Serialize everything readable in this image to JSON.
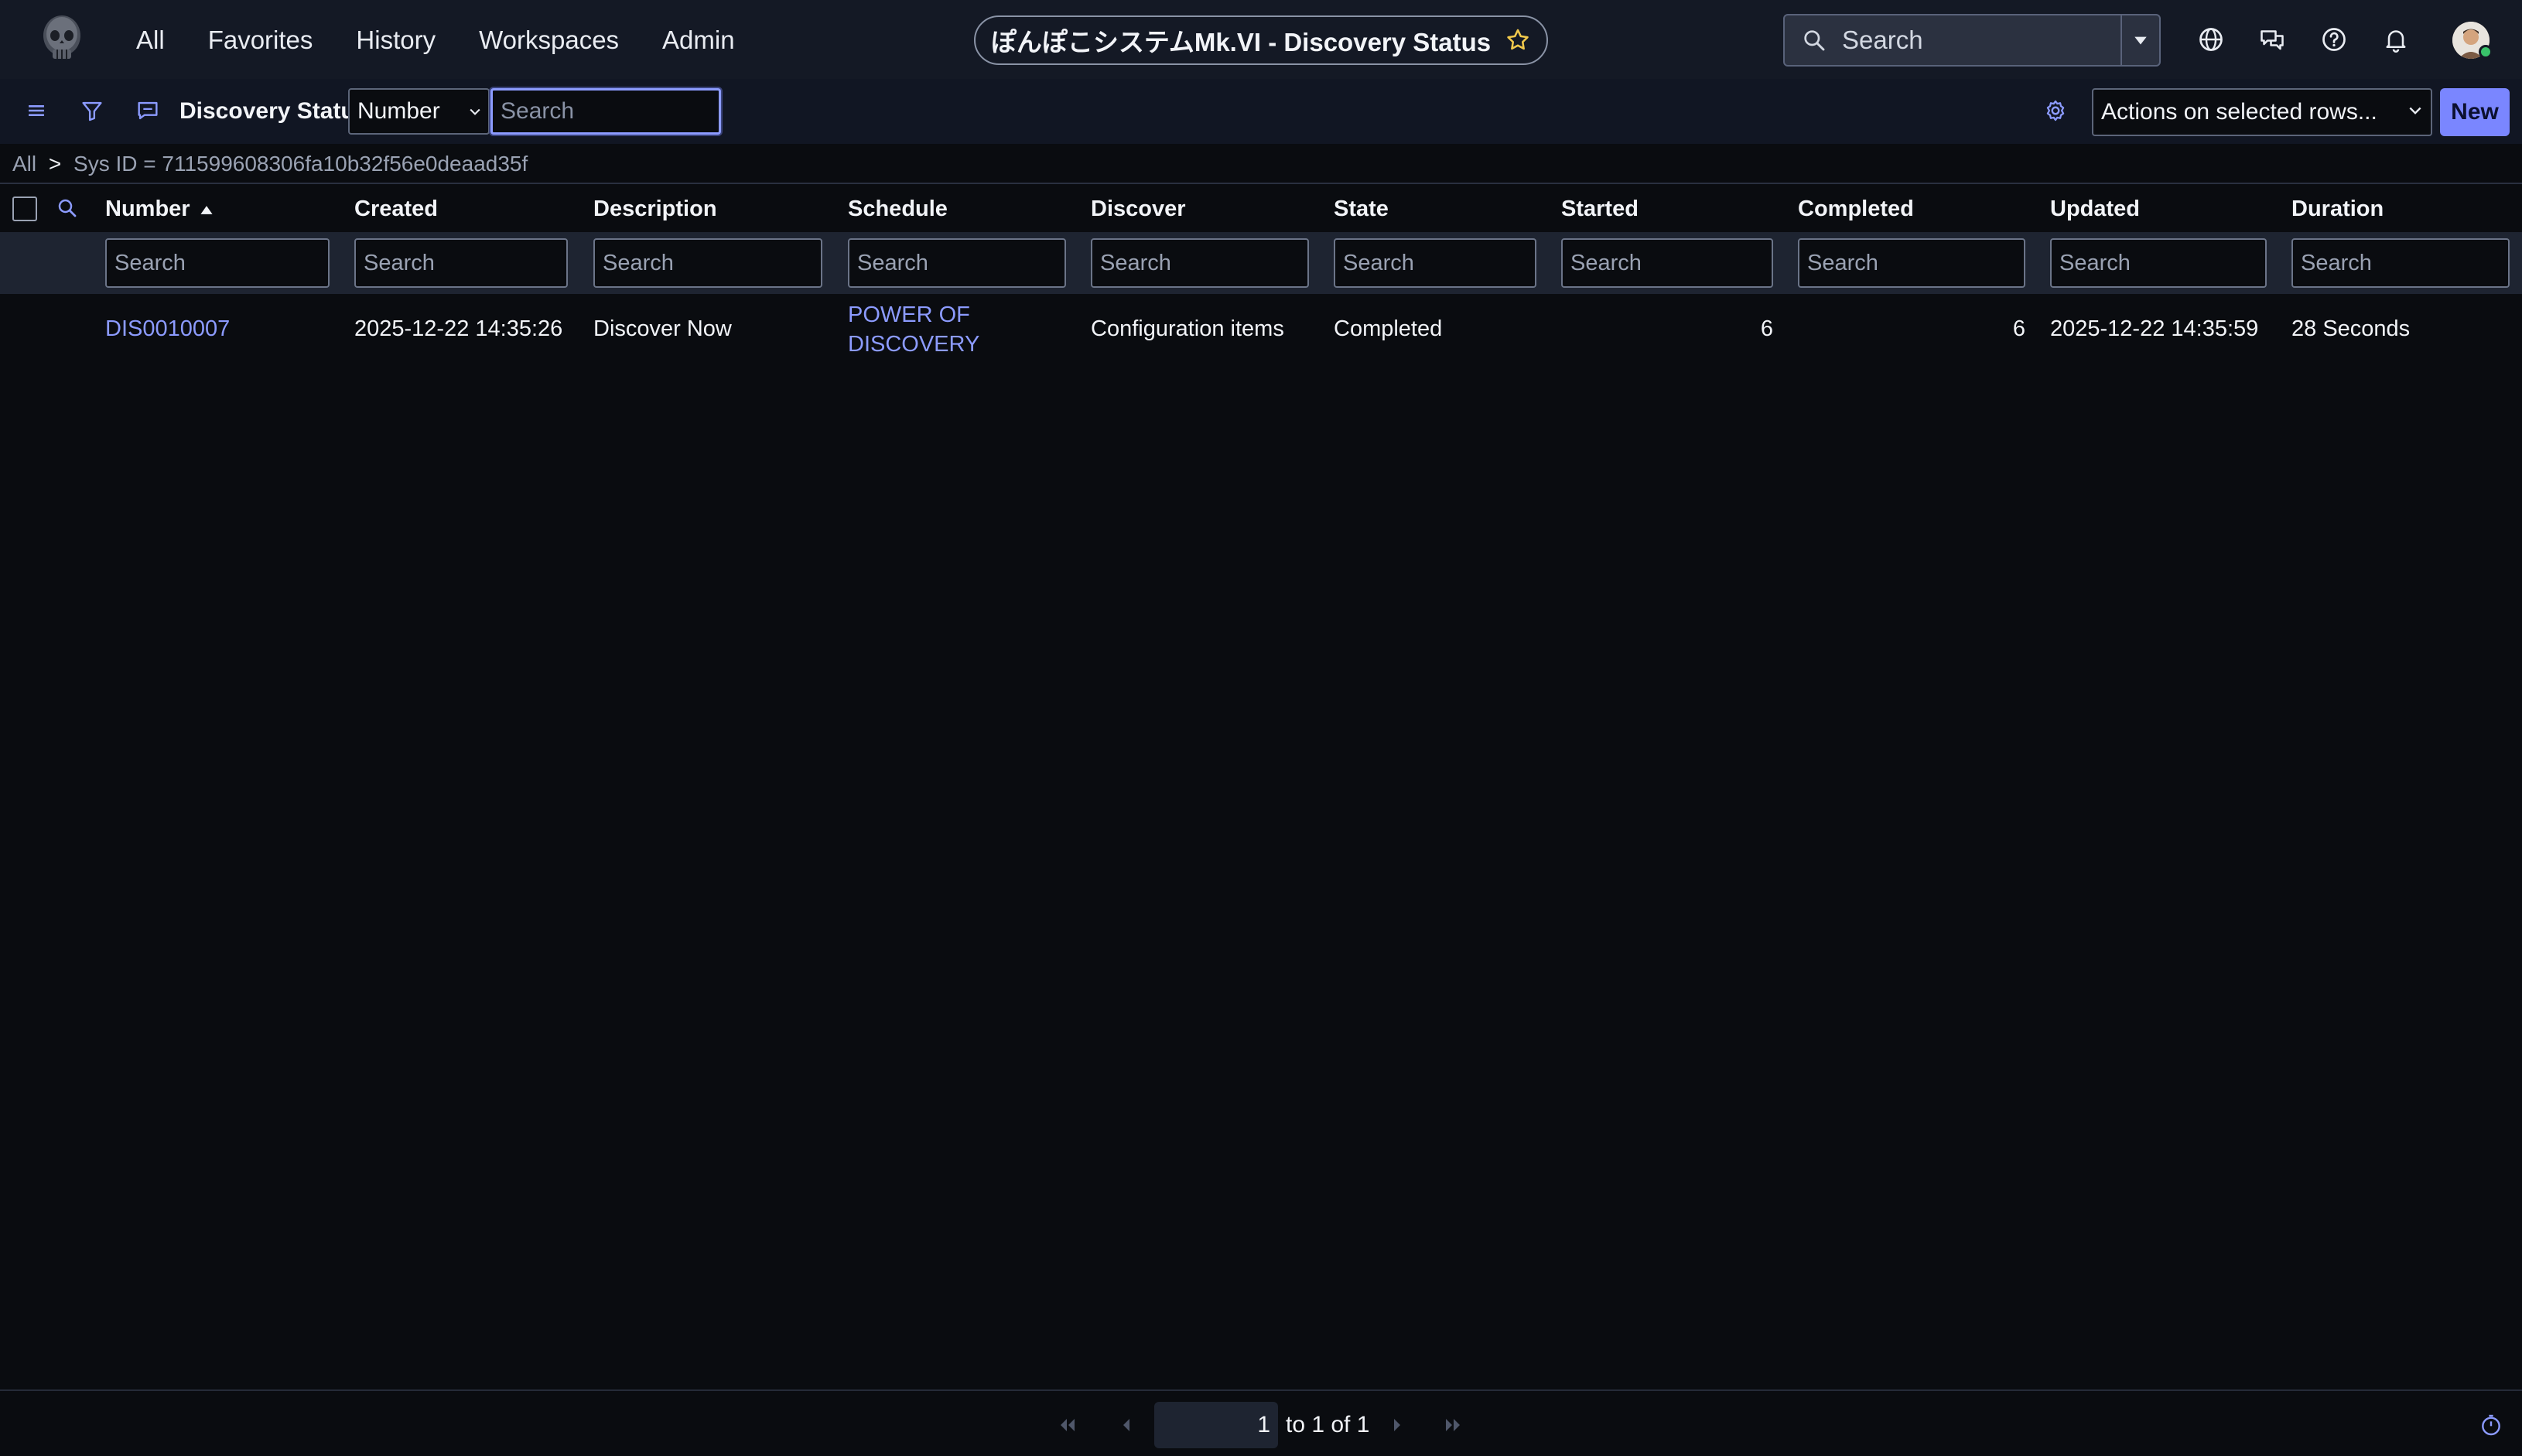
{
  "nav": {
    "menu": [
      "All",
      "Favorites",
      "History",
      "Workspaces",
      "Admin"
    ],
    "title": "ぽんぽこシステムMk.VI - Discovery Status",
    "search_placeholder": "Search",
    "icons": [
      "globe-icon",
      "chat-icon",
      "help-icon",
      "bell-icon"
    ],
    "avatar_status_color": "#39c26a"
  },
  "toolbar": {
    "list_title": "Discovery Status",
    "field_select_value": "Number",
    "search_placeholder": "Search",
    "actions_label": "Actions on selected rows...",
    "new_label": "New"
  },
  "breadcrumb": {
    "root": "All",
    "separator": ">",
    "condition": "Sys ID = 711599608306fa10b32f56e0deaad35f"
  },
  "table": {
    "columns": [
      "Number",
      "Created",
      "Description",
      "Schedule",
      "Discover",
      "State",
      "Started",
      "Completed",
      "Updated",
      "Duration"
    ],
    "sorted_column": "Number",
    "sort_direction": "ascending",
    "filter_placeholder": "Search",
    "rows": [
      {
        "number": "DIS0010007",
        "created": "2025-12-22 14:35:26",
        "description": "Discover Now",
        "schedule_line1": "POWER OF",
        "schedule_line2": "DISCOVERY",
        "discover": "Configuration items",
        "state": "Completed",
        "started": "6",
        "completed": "6",
        "updated": "2025-12-22 14:35:59",
        "duration": "28 Seconds"
      }
    ]
  },
  "pagination": {
    "current_page": "1",
    "range_text": "to 1 of 1"
  },
  "colors": {
    "accent": "#7a86ff",
    "link": "#8c9bff",
    "background": "#0a0c10",
    "nav_background": "#141925"
  }
}
